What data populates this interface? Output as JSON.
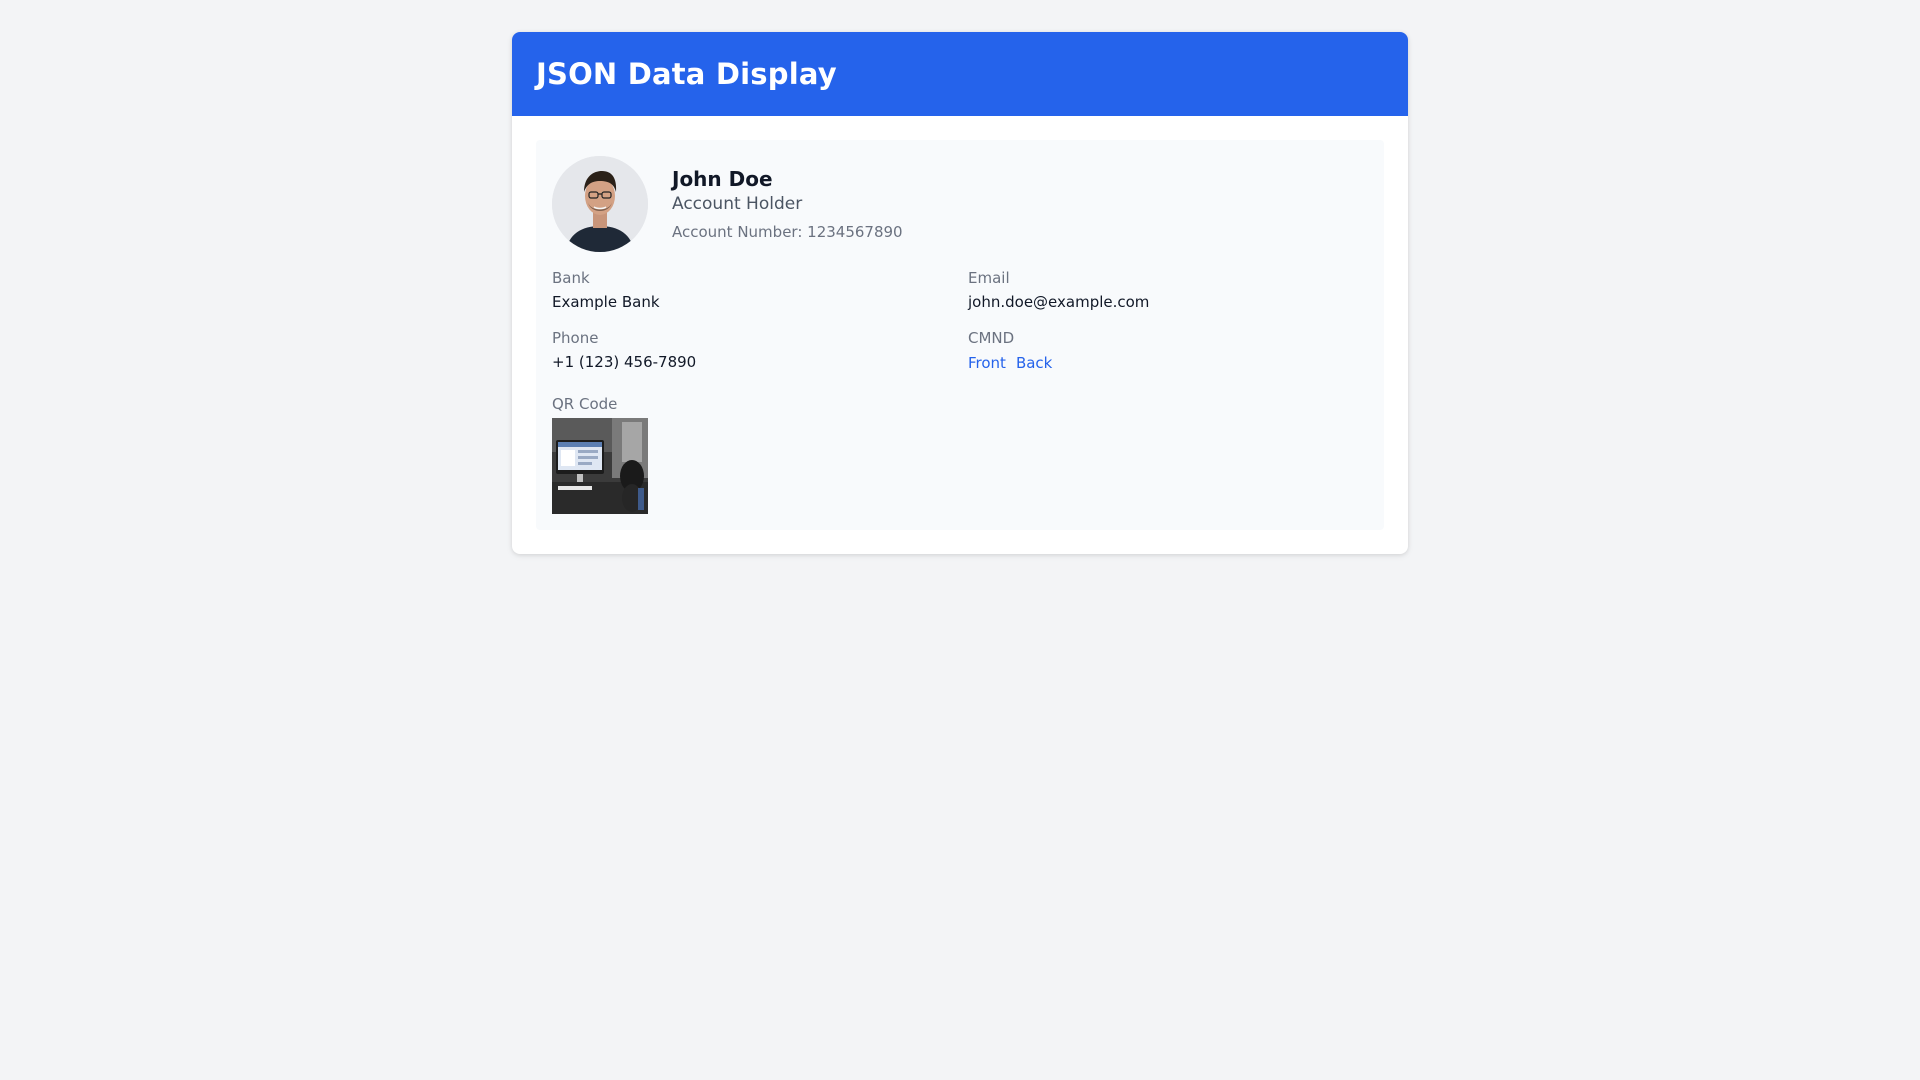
{
  "header": {
    "title": "JSON Data Display"
  },
  "profile": {
    "name": "John Doe",
    "role": "Account Holder",
    "account_number_text": "Account Number: 1234567890"
  },
  "fields": {
    "bank": {
      "label": "Bank",
      "value": "Example Bank"
    },
    "email": {
      "label": "Email",
      "value": "john.doe@example.com"
    },
    "phone": {
      "label": "Phone",
      "value": "+1 (123) 456-7890"
    },
    "cmnd": {
      "label": "CMND",
      "links": [
        "Front",
        "Back"
      ]
    },
    "qr": {
      "label": "QR Code"
    }
  },
  "colors": {
    "header_bg": "#2563eb",
    "link": "#2563eb",
    "page_bg": "#f3f4f6",
    "panel_bg": "#f8fafc"
  }
}
